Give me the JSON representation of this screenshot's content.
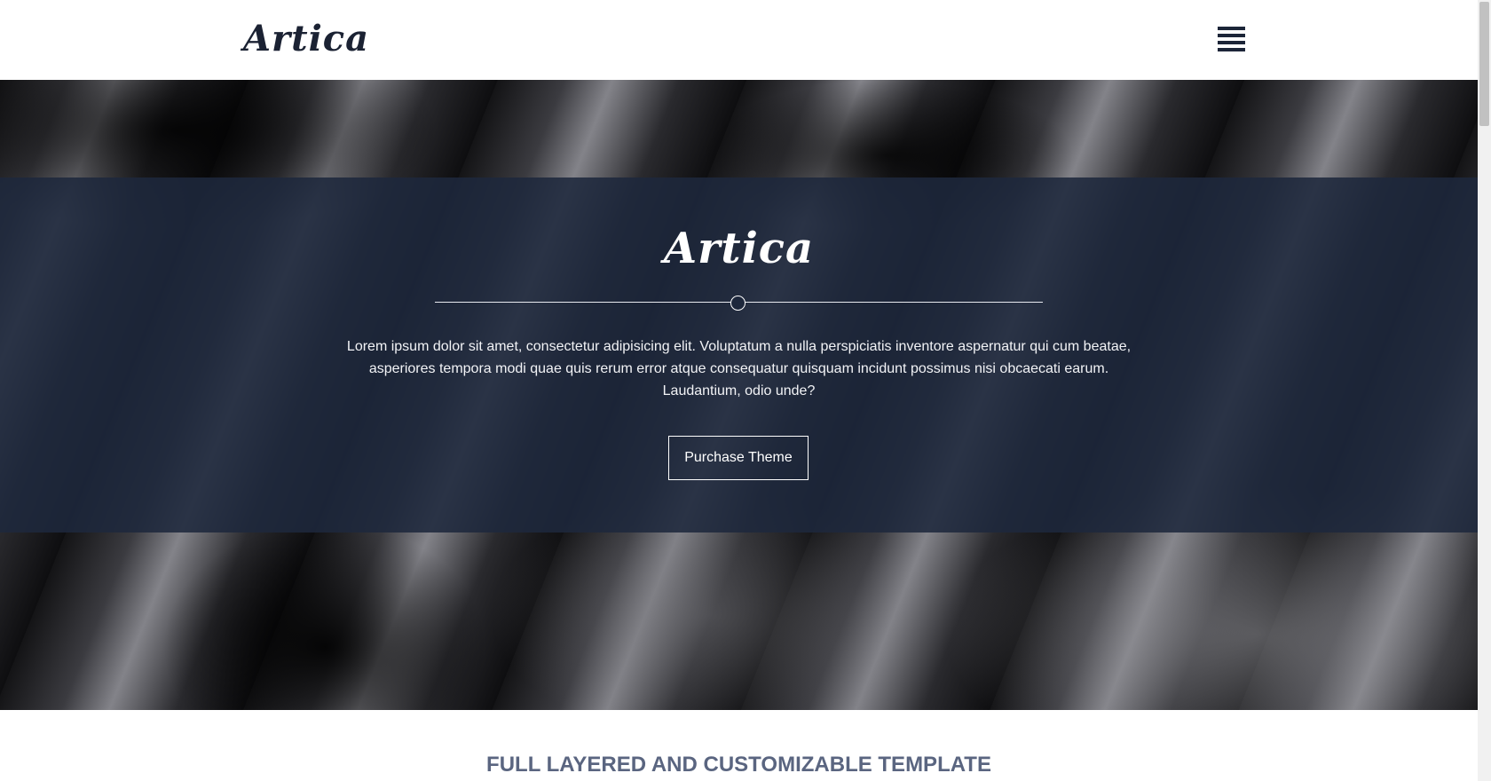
{
  "header": {
    "logo": "Artica",
    "menu_icon": "hamburger-menu-icon"
  },
  "hero": {
    "title": "Artica",
    "description": "Lorem ipsum dolor sit amet, consectetur adipisicing elit. Voluptatum a nulla perspiciatis inventore aspernatur qui cum beatae, asperiores tempora modi quae quis rerum error atque consequatur quisquam incidunt possimus nisi obcaecati earum. Laudantium, odio unde?",
    "button_label": "Purchase Theme"
  },
  "section": {
    "heading": "FULL LAYERED AND CUSTOMIZABLE TEMPLATE"
  },
  "colors": {
    "navy": "#1c2538",
    "band_overlay": "#1e283c",
    "heading": "#5a6580"
  }
}
